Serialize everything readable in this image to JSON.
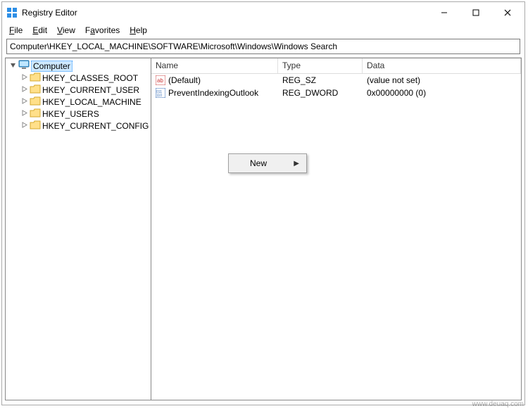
{
  "titlebar": {
    "title": "Registry Editor"
  },
  "menubar": {
    "file": "File",
    "edit": "Edit",
    "view": "View",
    "favorites": "Favorites",
    "help": "Help"
  },
  "addressbar": {
    "path": "Computer\\HKEY_LOCAL_MACHINE\\SOFTWARE\\Microsoft\\Windows\\Windows Search"
  },
  "tree": {
    "root": "Computer",
    "keys": [
      "HKEY_CLASSES_ROOT",
      "HKEY_CURRENT_USER",
      "HKEY_LOCAL_MACHINE",
      "HKEY_USERS",
      "HKEY_CURRENT_CONFIG"
    ]
  },
  "list": {
    "headers": {
      "name": "Name",
      "type": "Type",
      "data": "Data"
    },
    "rows": [
      {
        "name": "(Default)",
        "type": "REG_SZ",
        "data": "(value not set)",
        "icon": "string"
      },
      {
        "name": "PreventIndexingOutlook",
        "type": "REG_DWORD",
        "data": "0x00000000 (0)",
        "icon": "binary"
      }
    ]
  },
  "contextmenu": {
    "new": "New"
  },
  "watermark": "www.deuaq.com"
}
